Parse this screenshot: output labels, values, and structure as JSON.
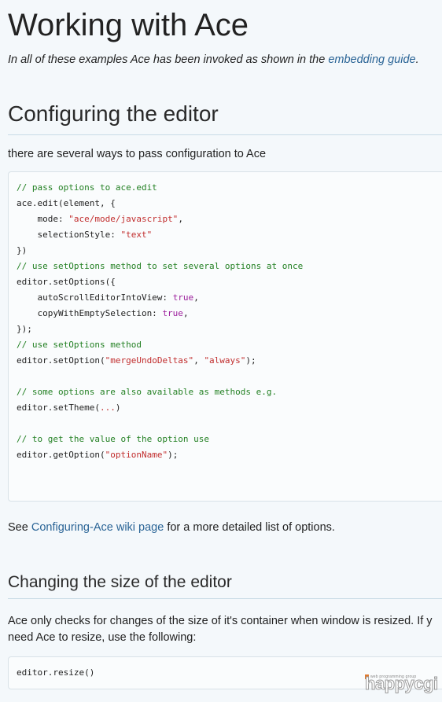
{
  "title": "Working with Ace",
  "intro": {
    "text": "In all of these examples Ace has been invoked as shown in the ",
    "link": "embedding guide",
    "end": "."
  },
  "section_config": {
    "heading": "Configuring the editor",
    "lead": "there are several ways to pass configuration to Ace",
    "code_lines": [
      [
        {
          "t": "c",
          "v": "// pass options to ace.edit"
        }
      ],
      [
        {
          "t": "p",
          "v": "ace.edit(element, {"
        }
      ],
      [
        {
          "t": "p",
          "v": "    mode: "
        },
        {
          "t": "s",
          "v": "\"ace/mode/javascript\""
        },
        {
          "t": "p",
          "v": ","
        }
      ],
      [
        {
          "t": "p",
          "v": "    selectionStyle: "
        },
        {
          "t": "s",
          "v": "\"text\""
        }
      ],
      [
        {
          "t": "p",
          "v": "})"
        }
      ],
      [
        {
          "t": "c",
          "v": "// use setOptions method to set several options at once"
        }
      ],
      [
        {
          "t": "p",
          "v": "editor.setOptions({"
        }
      ],
      [
        {
          "t": "p",
          "v": "    autoScrollEditorIntoView: "
        },
        {
          "t": "k",
          "v": "true"
        },
        {
          "t": "p",
          "v": ","
        }
      ],
      [
        {
          "t": "p",
          "v": "    copyWithEmptySelection: "
        },
        {
          "t": "k",
          "v": "true"
        },
        {
          "t": "p",
          "v": ","
        }
      ],
      [
        {
          "t": "p",
          "v": "});"
        }
      ],
      [
        {
          "t": "c",
          "v": "// use setOptions method"
        }
      ],
      [
        {
          "t": "p",
          "v": "editor.setOption("
        },
        {
          "t": "s",
          "v": "\"mergeUndoDeltas\""
        },
        {
          "t": "p",
          "v": ", "
        },
        {
          "t": "s",
          "v": "\"always\""
        },
        {
          "t": "p",
          "v": ");"
        }
      ],
      [],
      [
        {
          "t": "c",
          "v": "// some options are also available as methods e.g."
        }
      ],
      [
        {
          "t": "p",
          "v": "editor.setTheme("
        },
        {
          "t": "s",
          "v": "..."
        },
        {
          "t": "p",
          "v": ")"
        }
      ],
      [],
      [
        {
          "t": "c",
          "v": "// to get the value of the option use"
        }
      ],
      [
        {
          "t": "p",
          "v": "editor.getOption("
        },
        {
          "t": "s",
          "v": "\"optionName\""
        },
        {
          "t": "p",
          "v": ");"
        }
      ]
    ],
    "see_prefix": "See ",
    "see_link": "Configuring-Ace wiki page",
    "see_suffix": " for a more detailed list of options."
  },
  "section_resize": {
    "heading": "Changing the size of the editor",
    "line1": "Ace only checks for changes of the size of it's container when window is resized. If y",
    "line2": "need Ace to resize, use the following:",
    "code": "editor.resize()"
  },
  "watermark": {
    "small": "web programming group",
    "big": "happycgi"
  },
  "colors": {
    "link": "#2a6496",
    "comment": "#238023",
    "string": "#c12d2d",
    "keyword": "#9b1d9b"
  }
}
